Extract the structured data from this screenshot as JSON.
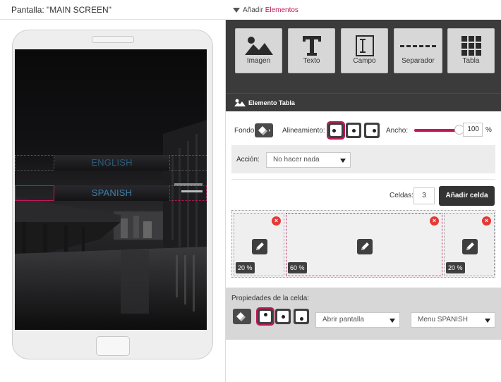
{
  "screen_header": {
    "title": "Pantalla: \"MAIN SCREEN\""
  },
  "add_elements": {
    "prefix": "Añadir",
    "accent": "Elementos"
  },
  "tools": [
    {
      "label": "Imagen",
      "icon": "image-icon"
    },
    {
      "label": "Texto",
      "icon": "text-icon"
    },
    {
      "label": "Campo",
      "icon": "field-icon"
    },
    {
      "label": "Separador",
      "icon": "separator-icon"
    },
    {
      "label": "Tabla",
      "icon": "table-icon"
    }
  ],
  "element_section": {
    "title": "Elemento Tabla",
    "icon": "image-icon"
  },
  "properties": {
    "fondo_label": "Fondo:",
    "alineamiento_label": "Alineamiento:",
    "ancho_label": "Ancho:",
    "ancho_value": "100",
    "ancho_unit": "%",
    "ancho_fraction": 1.0,
    "accion_label": "Acción:",
    "accion_value": "No hacer nada",
    "celdas_label": "Celdas:",
    "celdas_value": "3",
    "add_cell_label": "Añadir celda"
  },
  "table_cells": [
    {
      "percent": "20 %"
    },
    {
      "percent": "60 %"
    },
    {
      "percent": "20 %"
    }
  ],
  "cell_properties": {
    "title": "Propiedades de la celda:",
    "action_value": "Abrir pantalla",
    "target_value": "Menu SPANISH"
  },
  "phone_menu": {
    "english": "ENGLISH",
    "spanish": "SPANISH"
  },
  "colors": {
    "accent": "#c2185b",
    "toolbar_bg": "#3b3b3b",
    "menu_text": "#3f7ea8"
  }
}
